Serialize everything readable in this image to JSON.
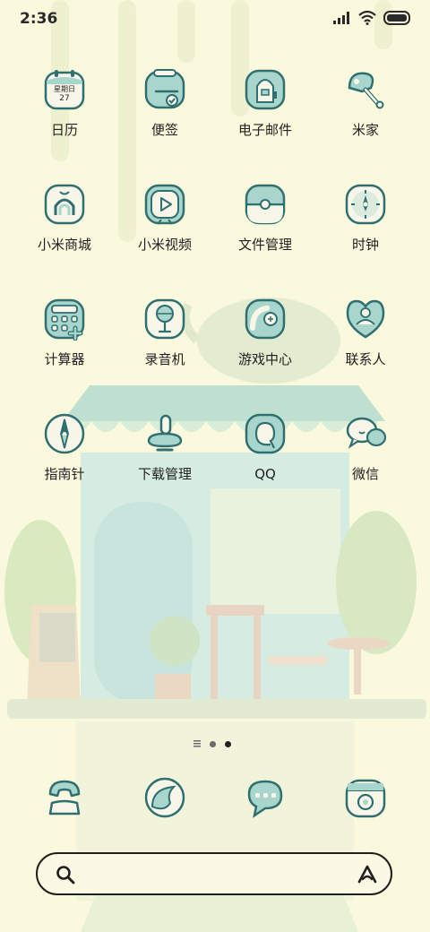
{
  "status_bar": {
    "time": "2:36"
  },
  "calendar_icon": {
    "weekday": "星期日",
    "day": "27"
  },
  "apps": [
    {
      "label": "日历",
      "icon": "calendar-icon"
    },
    {
      "label": "便签",
      "icon": "notes-icon"
    },
    {
      "label": "电子邮件",
      "icon": "email-icon"
    },
    {
      "label": "米家",
      "icon": "mijia-icon"
    },
    {
      "label": "小米商城",
      "icon": "mi-store-icon"
    },
    {
      "label": "小米视频",
      "icon": "video-play-icon"
    },
    {
      "label": "文件管理",
      "icon": "file-manager-icon"
    },
    {
      "label": "时钟",
      "icon": "clock-icon"
    },
    {
      "label": "计算器",
      "icon": "calculator-icon"
    },
    {
      "label": "录音机",
      "icon": "recorder-icon"
    },
    {
      "label": "游戏中心",
      "icon": "game-center-icon"
    },
    {
      "label": "联系人",
      "icon": "contacts-icon"
    },
    {
      "label": "指南针",
      "icon": "compass-icon"
    },
    {
      "label": "下载管理",
      "icon": "download-icon"
    },
    {
      "label": "QQ",
      "icon": "qq-icon"
    },
    {
      "label": "微信",
      "icon": "wechat-icon"
    }
  ],
  "dock": [
    {
      "icon": "phone-icon"
    },
    {
      "icon": "browser-icon"
    },
    {
      "icon": "messages-icon"
    },
    {
      "icon": "camera-icon"
    }
  ],
  "colors": {
    "background": "#fbf9dd",
    "icon_fill": "#a9d6cc",
    "icon_stroke": "#2f6f70",
    "text": "#222222"
  }
}
